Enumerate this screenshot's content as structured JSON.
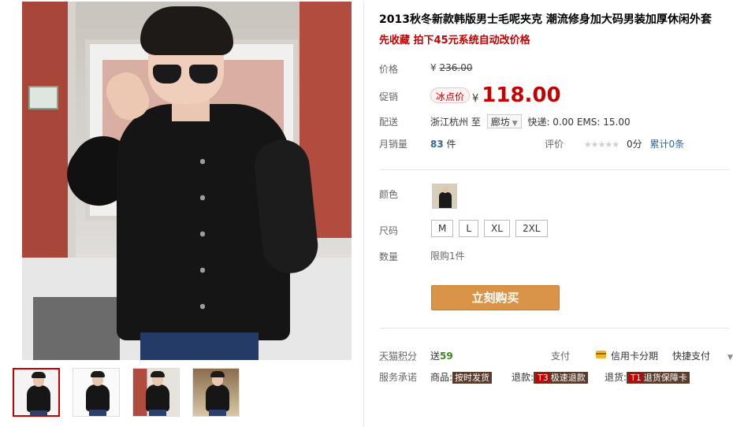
{
  "product": {
    "title": "2013秋冬新款韩版男士毛呢夹克 潮流修身加大码男装加厚休闲外套",
    "subtitle": "先收藏 拍下45元系统自动改价格"
  },
  "labels": {
    "price": "价格",
    "promo": "促销",
    "shipping": "配送",
    "monthly_sales": "月销量",
    "rating": "评价",
    "color": "颜色",
    "size": "尺码",
    "quantity": "数量",
    "points": "天猫积分",
    "payment": "支付",
    "service": "服务承诺"
  },
  "price": {
    "currency": "¥",
    "original": "236.00",
    "promo_badge": "冰点价",
    "promo_value": "118.00"
  },
  "shipping": {
    "from": "浙江杭州",
    "to_word": "至",
    "destination": "廊坊",
    "fees": "快递: 0.00 EMS: 15.00"
  },
  "sales": {
    "count": "83",
    "unit": "件"
  },
  "rating": {
    "stars": "★★★★★",
    "score": "0分",
    "total": "累计0条"
  },
  "sizes": [
    "M",
    "L",
    "XL",
    "2XL"
  ],
  "quantity_limit": "限购1件",
  "buy_button": "立刻购买",
  "points": {
    "prefix": "送",
    "value": "59"
  },
  "payment": {
    "credit": "信用卡分期",
    "quick": "快捷支付"
  },
  "services": {
    "goods_label": "商品:",
    "goods_tag": "按时发货",
    "refund_label": "退款:",
    "refund_code": "T3",
    "refund_tag": "极速退款",
    "return_label": "退货:",
    "return_code": "T1",
    "return_tag": "退货保障卡"
  },
  "colors": {
    "accent_red": "#c40000",
    "buy_button": "#d99448",
    "link_blue": "#336699",
    "points_green": "#3a8a1a"
  }
}
